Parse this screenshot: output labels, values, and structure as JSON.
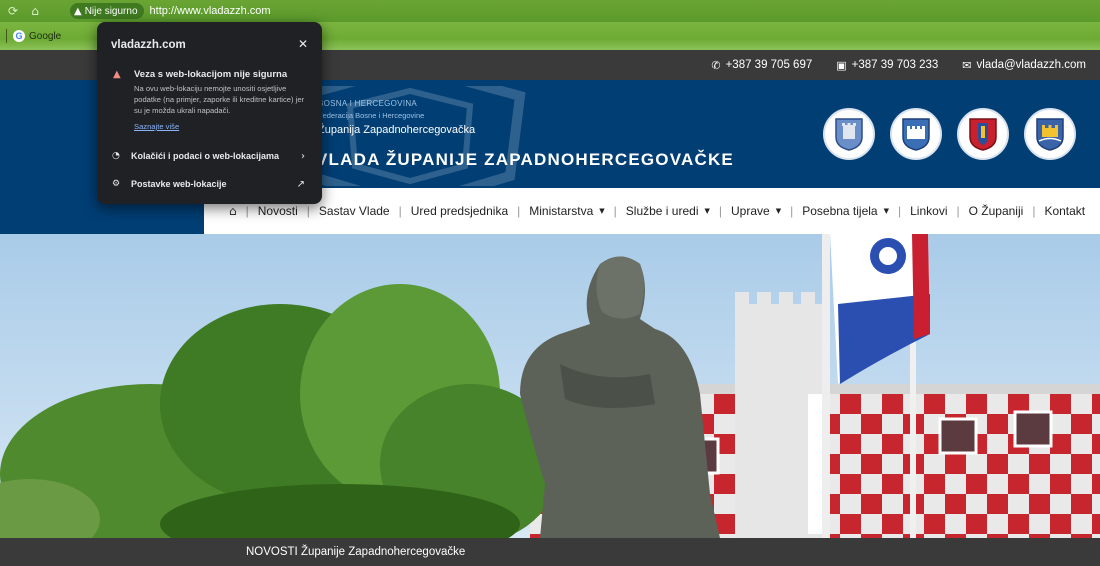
{
  "browser": {
    "security_chip": "Nije sigurno",
    "url": "http://www.vladazzh.com",
    "bookmarks": [
      {
        "label": "Google"
      }
    ]
  },
  "popup": {
    "domain": "vladazzh.com",
    "warning_title": "Veza s web-lokacijom nije sigurna",
    "warning_body": "Na ovu web-lokaciju nemojte unositi osjetljive podatke (na primjer, zaporke ili kreditne kartice) jer su je možda ukrali napadači.",
    "learn_more": "Saznajte više",
    "rows": [
      {
        "label": "Kolačići i podaci o web-lokacijama",
        "icon": "cookie-icon"
      },
      {
        "label": "Postavke web-lokacije",
        "icon": "gear-icon"
      }
    ]
  },
  "contacts": {
    "phone": "+387 39 705 697",
    "fax": "+387 39 703 233",
    "email": "vlada@vladazzh.com"
  },
  "header": {
    "country": "BOSNA I HERCEGOVINA",
    "federation": "Federacija Bosne i Hercegovine",
    "county": "Županija Zapadnohercegovačka",
    "title": "VLADA ŽUPANIJE ZAPADNOHERCEGOVAČKE"
  },
  "nav": {
    "items": [
      {
        "label": "Novosti",
        "dropdown": false
      },
      {
        "label": "Sastav Vlade",
        "dropdown": false
      },
      {
        "label": "Ured predsjednika",
        "dropdown": false
      },
      {
        "label": "Ministarstva",
        "dropdown": true
      },
      {
        "label": "Službe i uredi",
        "dropdown": true
      },
      {
        "label": "Uprave",
        "dropdown": true
      },
      {
        "label": "Posebna tijela",
        "dropdown": true
      },
      {
        "label": "Linkovi",
        "dropdown": false
      },
      {
        "label": "O Županiji",
        "dropdown": false
      },
      {
        "label": "Kontakt",
        "dropdown": false
      }
    ]
  },
  "news_bar": {
    "text": "NOVOSTI Županije Zapadnohercegovačke"
  },
  "colors": {
    "header_blue": "#003e74",
    "topbar": "#3a3a3a",
    "chrome_green": "#6aa534",
    "popup_bg": "#202124",
    "link_blue": "#8ab4f8",
    "warning_red": "#f28b82"
  }
}
